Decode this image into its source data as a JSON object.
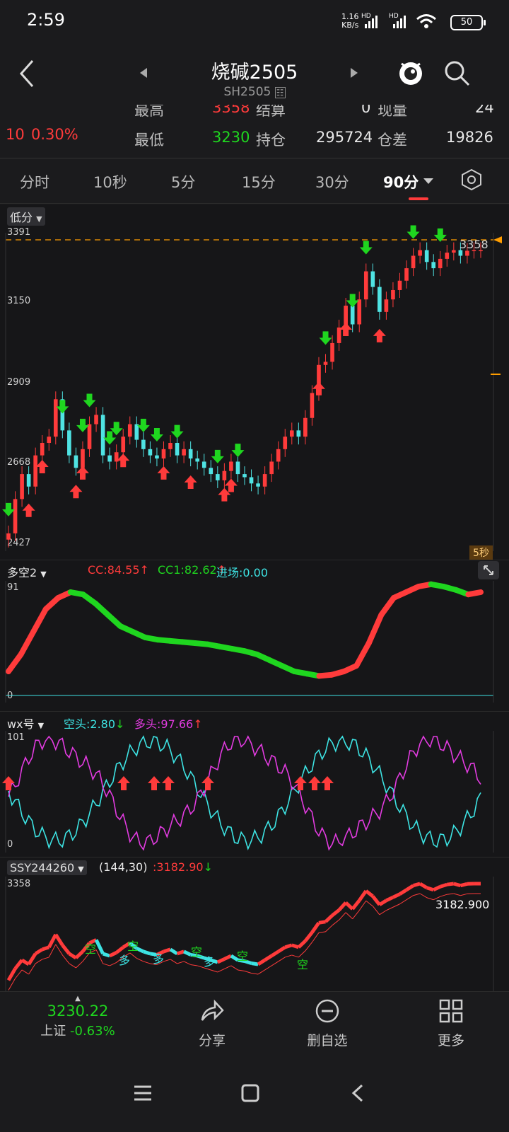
{
  "status": {
    "time": "2:59",
    "net_speed": "1.16",
    "net_unit": "KB/s",
    "sim1": "HD",
    "sim2": "HD",
    "battery": "50"
  },
  "header": {
    "title": "烧碱2505",
    "code": "SH2505"
  },
  "quote": {
    "change": "10",
    "change_pct": "0.30%",
    "high_label": "最高",
    "high": "3358",
    "settle_label": "结算",
    "settle": "0",
    "vol_label": "现量",
    "vol": "24",
    "low_label": "最低",
    "low": "3230",
    "oi_label": "持仓",
    "oi": "295724",
    "oi_diff_label": "仓差",
    "oi_diff": "19826"
  },
  "tabs": [
    "分时",
    "10秒",
    "5分",
    "15分",
    "30分",
    "90分"
  ],
  "active_tab": "90分",
  "main_chart": {
    "selector": "低分",
    "y_ticks": [
      "3391",
      "3150",
      "2909",
      "2668",
      "2427"
    ],
    "last_price_tag": "3358",
    "period_badge": "5秒"
  },
  "indicator1": {
    "name": "多空2",
    "cc_label": "CC:",
    "cc": "84.55",
    "cc1_label": "CC1:",
    "cc1": "82.62",
    "entry_label": "进场:",
    "entry": "0.00",
    "y_top": "91",
    "y_bottom": "0"
  },
  "indicator2": {
    "name": "wx号",
    "short_label": "空头:",
    "short": "2.80",
    "long_label": "多头:",
    "long": "97.66",
    "y_top": "101",
    "y_bottom": "0"
  },
  "indicator3": {
    "name": "SSY244260",
    "params": "(144,30)",
    "value": ":3182.90",
    "y_top": "3358",
    "overlay_value": "3182.900",
    "labels": [
      "空",
      "空",
      "多",
      "多",
      "空",
      "多",
      "空",
      "空"
    ]
  },
  "bottom_nav": {
    "index_value": "3230.22",
    "index_name": "上证",
    "index_change": "-0.63%",
    "share": "分享",
    "remove_watch": "删自选",
    "more": "更多"
  },
  "colors": {
    "up": "#ff3b3b",
    "down": "#1fd61f",
    "cyan": "#3de3e3",
    "magenta": "#e23be0",
    "accent": "#ff9d00"
  },
  "chart_data": {
    "type": "candlestick",
    "title": "烧碱2505",
    "ylim": [
      2427,
      3391
    ],
    "x": [
      0,
      1,
      2,
      3,
      4,
      5,
      6,
      7,
      8,
      9,
      10,
      11,
      12,
      13,
      14,
      15,
      16,
      17,
      18,
      19,
      20,
      21,
      22,
      23,
      24,
      25,
      26,
      27,
      28,
      29,
      30,
      31,
      32,
      33,
      34,
      35,
      36,
      37,
      38,
      39,
      40,
      41,
      42,
      43,
      44,
      45,
      46,
      47,
      48,
      49,
      50,
      51,
      52,
      53,
      54,
      55,
      56,
      57,
      58,
      59,
      60,
      61,
      62,
      63,
      64,
      65,
      66,
      67,
      68,
      69,
      70
    ],
    "close": [
      2450,
      2560,
      2640,
      2600,
      2700,
      2740,
      2760,
      2880,
      2780,
      2700,
      2660,
      2720,
      2800,
      2830,
      2700,
      2680,
      2710,
      2760,
      2800,
      2750,
      2720,
      2700,
      2690,
      2720,
      2740,
      2700,
      2720,
      2690,
      2680,
      2660,
      2640,
      2620,
      2650,
      2680,
      2640,
      2630,
      2610,
      2600,
      2640,
      2680,
      2720,
      2760,
      2780,
      2760,
      2820,
      2900,
      2990,
      3000,
      3060,
      3110,
      3180,
      3120,
      3200,
      3290,
      3240,
      3160,
      3200,
      3230,
      3260,
      3300,
      3340,
      3358,
      3320,
      3300,
      3330,
      3350,
      3358,
      3340,
      3356,
      3358,
      3358
    ],
    "buy_signals_index": [
      3,
      5,
      10,
      11,
      17,
      23,
      27,
      32,
      33,
      46,
      50,
      55
    ],
    "sell_signals_index": [
      0,
      8,
      11,
      12,
      15,
      16,
      20,
      22,
      25,
      31,
      34,
      47,
      51,
      53,
      60,
      64
    ]
  }
}
